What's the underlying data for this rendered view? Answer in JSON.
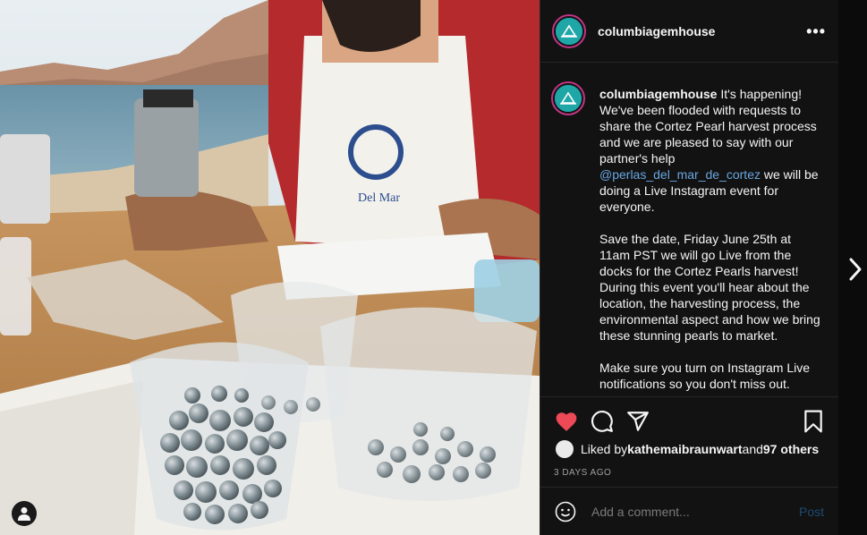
{
  "post": {
    "username": "columbiagemhouse",
    "more_label": "•••",
    "caption_user": "columbiagemhouse",
    "caption_part1": " It's happening! We've been flooded with requests to share the Cortez Pearl harvest process and we are pleased to say with our partner's help ",
    "mention": "@perlas_del_mar_de_cortez",
    "caption_part2": " we will be doing a Live Instagram event for everyone.\n\nSave the date, Friday June 25th at 11am PST we will go Live from the docks for the Cortez Pearls harvest! During this event you'll hear about the location, the harvesting process, the environmental aspect and how we bring these stunning pearls to market.\n\nMake sure you turn on Instagram Live notifications so you don't miss out.",
    "liked_by_prefix": "Liked by ",
    "liked_by_user": "kathemaibraunwart",
    "liked_by_mid": " and ",
    "liked_by_others": "97 others",
    "timestamp": "3 DAYS AGO"
  },
  "comment": {
    "placeholder": "Add a comment...",
    "post_label": "Post"
  },
  "colors": {
    "like": "#ed4956",
    "mention": "#6aa6e0",
    "post_disabled": "#1d4a70",
    "avatar_ring": "#c13584",
    "avatar_fill": "#1fa7a8"
  },
  "icons": [
    "heart-icon",
    "comment-icon",
    "share-icon",
    "bookmark-icon",
    "emoji-icon",
    "more-icon",
    "chevron-right-icon",
    "user-tag-icon"
  ]
}
